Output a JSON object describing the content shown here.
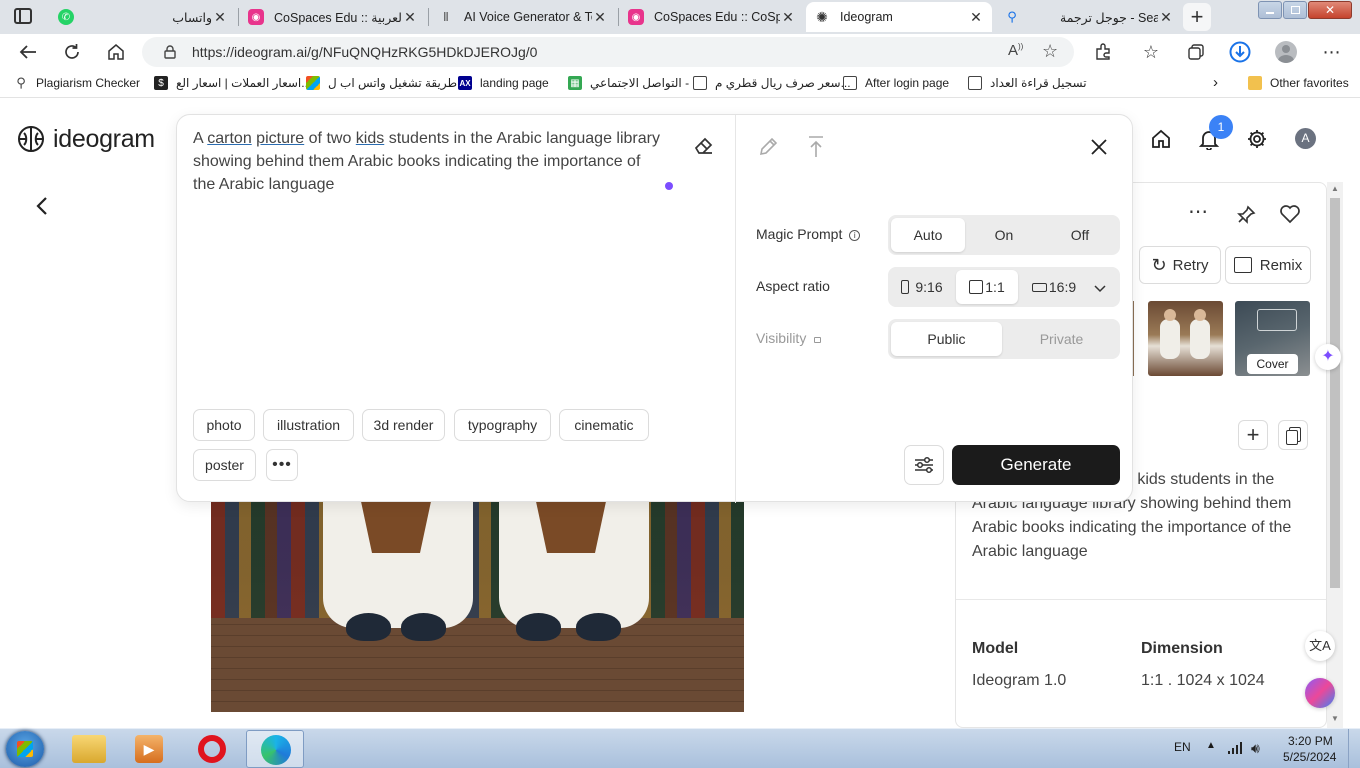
{
  "tabs": [
    {
      "label": "واتساب",
      "icon": "whatsapp-icon"
    },
    {
      "label": "CoSpaces Edu :: العربية",
      "icon": "cospaces-icon"
    },
    {
      "label": "AI Voice Generator & Te",
      "icon": "voice-generator-icon"
    },
    {
      "label": "CoSpaces Edu :: CoSpac",
      "icon": "cospaces-icon"
    },
    {
      "label": "Ideogram",
      "icon": "ideogram-icon"
    },
    {
      "label": "جوجل ترجمة - Search",
      "icon": "search-icon"
    }
  ],
  "address": {
    "url": "https://ideogram.ai/g/NFuQNQHzRKG5HDkDJEROJg/0"
  },
  "bookmarks": [
    {
      "label": "Plagiarism Checker"
    },
    {
      "label": "اسعار العملات | اسعار الع..."
    },
    {
      "label": "طريقة تشغيل واتس اب ل..."
    },
    {
      "label": "landing page"
    },
    {
      "label": "التواصل الاجتماعي -"
    },
    {
      "label": "سعر صرف ريال قطري م..."
    },
    {
      "label": "After login page"
    },
    {
      "label": "تسجيل قراءة العداد"
    }
  ],
  "bookmarks_other": "Other favorites",
  "app": {
    "logo": "ideogram",
    "notification_count": "1",
    "avatar_letter": "A"
  },
  "prompt": {
    "w1": "A",
    "w2": "carton",
    "w3": "picture",
    "w4": "of two",
    "w5": "kids",
    "w6": "students in the Arabic language library",
    "line2": "showing behind them Arabic books indicating the importance of",
    "line3": "the Arabic language"
  },
  "style_chips": [
    "photo",
    "illustration",
    "3d render",
    "typography",
    "cinematic",
    "poster"
  ],
  "settings": {
    "magic_prompt_label": "Magic Prompt",
    "magic_prompt_options": [
      "Auto",
      "On",
      "Off"
    ],
    "aspect_label": "Aspect ratio",
    "aspect_options": [
      "9:16",
      "1:1",
      "16:9"
    ],
    "visibility_label": "Visibility",
    "visibility_options": [
      "Public",
      "Private"
    ]
  },
  "generate_label": "Generate",
  "detail": {
    "retry": "Retry",
    "remix": "Remix",
    "cover": "Cover",
    "prompt_line1": "o kids students in the",
    "prompt_line2": "Arabic language library showing behind them",
    "prompt_line3": "Arabic books indicating the importance of the",
    "prompt_line4": "Arabic language",
    "model_label": "Model",
    "model_value": "Ideogram 1.0",
    "dimension_label": "Dimension",
    "dimension_value": "1:1 . 1024 x 1024"
  },
  "system": {
    "lang": "EN",
    "time": "3:20 PM",
    "date": "5/25/2024"
  },
  "colors": {
    "accent_blue": "#1a73e8",
    "magic_purple": "#7c4dff",
    "generate_bg": "#1b1b1b"
  }
}
